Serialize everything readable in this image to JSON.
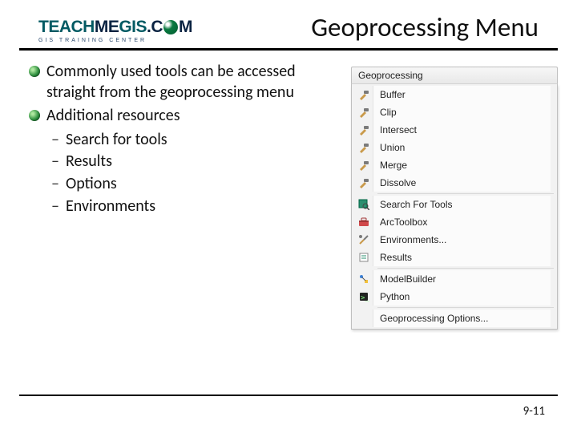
{
  "logo": {
    "text1": "TEACH",
    "text2": "ME",
    "text3": "GIS",
    "text4": ".C",
    "text5": "M",
    "sub": "GIS TRAINING CENTER"
  },
  "title": "Geoprocessing Menu",
  "bullets": {
    "b1": "Commonly used tools can be accessed straight from the geoprocessing menu",
    "b2": "Additional resources",
    "subs": {
      "s1": "Search for tools",
      "s2": "Results",
      "s3": "Options",
      "s4": "Environments"
    }
  },
  "menu": {
    "header": "Geoprocessing",
    "items": {
      "i0": "Buffer",
      "i1": "Clip",
      "i2": "Intersect",
      "i3": "Union",
      "i4": "Merge",
      "i5": "Dissolve",
      "i6": "Search For Tools",
      "i7": "ArcToolbox",
      "i8": "Environments...",
      "i9": "Results",
      "i10": "ModelBuilder",
      "i11": "Python",
      "i12": "Geoprocessing Options..."
    }
  },
  "page": "9-11"
}
